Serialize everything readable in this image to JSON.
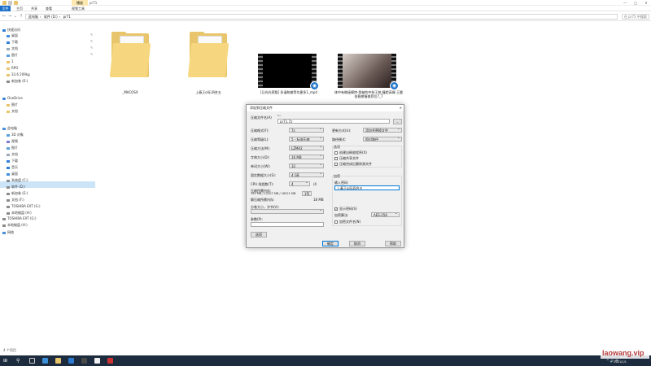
{
  "window": {
    "manage_tab": "播放",
    "title": "pr71",
    "controls": [
      "—",
      "□",
      "✕"
    ]
  },
  "ribbon": {
    "file": "文件",
    "tabs": [
      "主页",
      "共享",
      "查看",
      "视频工具"
    ]
  },
  "address": {
    "path": [
      "此电脑",
      "软件 (D:)",
      "pr71"
    ],
    "search_placeholder": "在 pr71 中搜索"
  },
  "sidebar": {
    "quick_access": "快速访问",
    "items_quick": [
      "桌面",
      "下载",
      "文档",
      "图片",
      "1",
      "RPO",
      "33.6 209kg",
      "新加卷 (E:)"
    ],
    "onedrive": "OneDrive",
    "onedrive_items": [
      "图片",
      "文档"
    ],
    "this_pc": "此电脑",
    "pc_items": [
      "3D 对象",
      "视频",
      "图片",
      "文档",
      "下载",
      "音乐",
      "桌面",
      "系统盘 (C:)",
      "软件 (D:)",
      "新加卷 (E:)",
      "文档 (F:)",
      "TOSHIBA EXT (G:)",
      "本地磁盘 (H:)"
    ],
    "extra": [
      "TOSHIBA EXT (G:)",
      "本地磁盘 (H:)"
    ],
    "network": "网络"
  },
  "files": [
    {
      "name": "_MACOSX",
      "kind": "folder"
    },
    {
      "name": "上春王ol乐四合五",
      "kind": "folder"
    },
    {
      "name": "[日向光荣版] 多请和着等均更多1_mp4",
      "kind": "video"
    },
    {
      "name": "体中有做接模特-我被的中秋王统,撞脸高端 王晨 张稳感情推荐位7_7",
      "kind": "video"
    }
  ],
  "status_bar": "4 个项目",
  "dialog": {
    "title": "添加到压缩文件",
    "close": "✕",
    "archive_name_label": "压缩文件名(A)",
    "archive_name_value": "pr71.7z",
    "browse": "...",
    "format_label": "压缩格式(F):",
    "format_value": "7z",
    "level_label": "压缩等级(L):",
    "level_value": "5 - 标准压缩",
    "method_label": "压缩方法(M):",
    "method_value": "LZMA2",
    "dict_label": "字典大小(D):",
    "dict_value": "16 MB",
    "word_label": "单词大小(W):",
    "word_value": "32",
    "solid_label": "固实数据大小(S):",
    "solid_value": "4 GB",
    "threads_label": "CPU 线程数(T):",
    "threads_value": "4",
    "threads_max": "/4",
    "mem_label": "压缩所需内存:",
    "mem_value": "192 MB / 12207 MB / 16221 MB",
    "mem_percent": "1%",
    "decomp_label": "解压缩所需内存:",
    "decomp_value": "18 MB",
    "volume_label": "分卷大小，字节(V):",
    "volume_value": "",
    "params_label": "参数(P):",
    "params_value": "",
    "options_button": "选项",
    "update_label": "更新方式(U):",
    "update_value": "添加并替换文件",
    "path_label": "路径模式:",
    "path_value": "相对路径",
    "opt_group": "选项",
    "opt_sfx": "创建自释放程序(X)",
    "opt_shared": "压缩共享文件",
    "opt_delete": "压缩完成后删除源文件",
    "enc_group": "加密",
    "pwd_label": "输入密码:",
    "pwd_value": "上春王ol乐四合五",
    "show_pwd": "显示密码(S)",
    "enc_method_label": "加密算法:",
    "enc_method_value": "AES-256",
    "enc_names": "加密文件名(N)",
    "ok": "确定",
    "cancel": "取消",
    "help": "帮助"
  },
  "taskbar": {
    "tray_text": "^ 🔊 中",
    "time": "0:00",
    "date": "2021/1/1"
  },
  "watermark": "laowang.vip",
  "colors": {
    "accent": "#0078d7",
    "folder": "#f6d77f",
    "selection": "#cce4f7",
    "taskbar": "#1c2b3d"
  }
}
